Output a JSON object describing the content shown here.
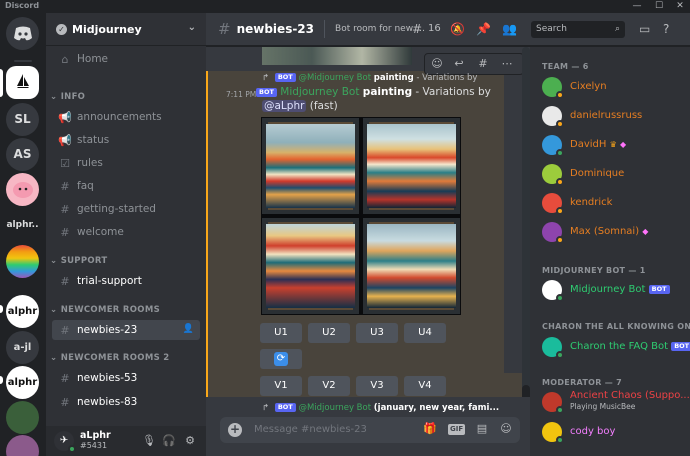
{
  "window": {
    "app_name": "Discord",
    "minimize": "—",
    "maximize": "☐",
    "close": "✕"
  },
  "rail": {
    "servers": [
      {
        "name": "SL",
        "label": "SL"
      },
      {
        "name": "AS",
        "label": "AS"
      },
      {
        "name": "alphr-text",
        "label": "alphr.."
      },
      {
        "name": "a-jl",
        "label": "a-jl"
      },
      {
        "name": "alphr-logo",
        "label": "alphr"
      }
    ]
  },
  "sidebar": {
    "guild_name": "Midjourney",
    "home": "Home",
    "categories": {
      "info": "INFO",
      "support": "SUPPORT",
      "newcomer_rooms": "NEWCOMER ROOMS",
      "newcomer_rooms_2": "NEWCOMER ROOMS 2"
    },
    "channels": {
      "announcements": "announcements",
      "status": "status",
      "rules": "rules",
      "faq": "faq",
      "getting_started": "getting-started",
      "welcome": "welcome",
      "trial_support": "trial-support",
      "newbies_23": "newbies-23",
      "newbies_53": "newbies-53",
      "newbies_83": "newbies-83"
    },
    "user": {
      "name": "aLphr",
      "tag": "#5431"
    }
  },
  "header": {
    "channel_name": "newbies-23",
    "topic": "Bot room for new u...",
    "thread_count": "16",
    "search_placeholder": "Search"
  },
  "chat": {
    "reply_bot_badge": "BOT",
    "reply_author": "@Midjourney Bot",
    "reply_prompt": "painting",
    "reply_suffix": " - Variations by",
    "time": "7:11 PM",
    "author": "Midjourney Bot",
    "bot_badge": "BOT",
    "prompt": "painting",
    "variations_text": " - Variations by",
    "mention": "@aLphr",
    "speed": "(fast)",
    "upscale_buttons": [
      "U1",
      "U2",
      "U3",
      "U4"
    ],
    "variation_buttons": [
      "V1",
      "V2",
      "V3",
      "V4"
    ],
    "next_reply_author": "@Midjourney Bot",
    "next_reply_prompt": "(january, new year, fami..."
  },
  "composer": {
    "placeholder": "Message #newbies-23",
    "gif_label": "GIF"
  },
  "members": {
    "team_header": "TEAM — 6",
    "team": [
      {
        "name": "Cixelyn"
      },
      {
        "name": "danielrussruss"
      },
      {
        "name": "DavidH"
      },
      {
        "name": "Dominique"
      },
      {
        "name": "kendrick"
      },
      {
        "name": "Max (Somnai)"
      }
    ],
    "midjourney_bot_header": "MIDJOURNEY BOT — 1",
    "midjourney_bot": {
      "name": "Midjourney Bot",
      "badge": "BOT"
    },
    "charon_header": "CHARON THE ALL KNOWING ON...",
    "charon": {
      "name": "Charon the FAQ Bot",
      "badge": "BOT"
    },
    "moderator_header": "MODERATOR — 7",
    "moderators": [
      {
        "name": "Ancient Chaos (Suppo...",
        "activity": "Playing MusicBee"
      },
      {
        "name": "cody boy"
      }
    ]
  },
  "colors": {
    "accent": "#5865f2",
    "online": "#3ba55d",
    "mention_highlight": "#faa81a"
  }
}
